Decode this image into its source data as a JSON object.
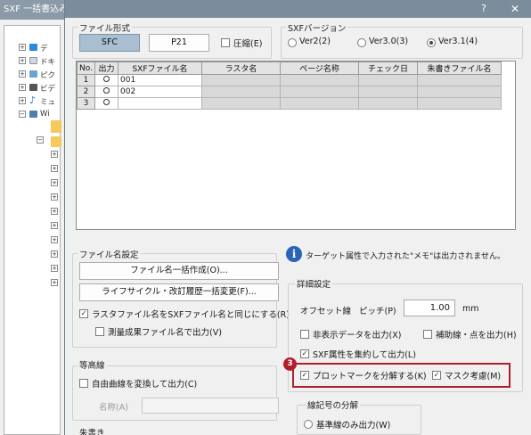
{
  "background_window": {
    "title": "SXF 一括書込み",
    "tree_items": [
      "デ",
      "ドキ",
      "ピク",
      "ビデ",
      "ミュ",
      "Wi"
    ]
  },
  "dialog": {
    "help": "?",
    "close": "✕",
    "file_format": {
      "title": "ファイル形式",
      "sfc": "SFC",
      "p21": "P21",
      "compress": "圧縮(E)"
    },
    "sxf_version": {
      "title": "SXFバージョン",
      "options": [
        "Ver2(2)",
        "Ver3.0(3)",
        "Ver3.1(4)"
      ],
      "selected": "Ver3.1(4)"
    },
    "grid": {
      "headers": [
        "No.",
        "出力",
        "SXFファイル名",
        "ラスタ名",
        "ページ名称",
        "チェック日",
        "朱書きファイル名"
      ],
      "rows": [
        {
          "no": "1",
          "out": "○",
          "name": "001"
        },
        {
          "no": "2",
          "out": "○",
          "name": "002"
        },
        {
          "no": "3",
          "out": "○",
          "name": ""
        }
      ]
    },
    "filename_settings": {
      "title": "ファイル名設定",
      "bulk_create": "ファイル名一括作成(O)...",
      "bulk_change": "ライフサイクル・改訂履歴一括変更(F)...",
      "same_as_sxf": "ラスタファイル名をSXFファイル名と同じにする(R)",
      "survey_output": "測量成果ファイル名で出力(V)"
    },
    "contour": {
      "title": "等高線",
      "convert_free_curve": "自由曲線を変換して出力(C)",
      "name_label": "名称(A)"
    },
    "red_writing_title": "朱書き",
    "info_text": "ターゲット属性で入力された\"メモ\"は出力されません。",
    "details": {
      "title": "詳細設定",
      "offset_line": "オフセット線",
      "pitch_label": "ピッチ(P)",
      "pitch_value": "1.00",
      "unit": "mm",
      "hidden_data": "非表示データを出力(X)",
      "aux_lines": "補助線・点を出力(H)",
      "aggregate_attr": "SXF属性を集約して出力(L)",
      "split_plot_mark": "プロットマークを分解する(K)",
      "mask": "マスク考慮(M)"
    },
    "line_symbol": {
      "title": "線記号の分解",
      "base_only": "基準線のみ出力(W)"
    },
    "badge": "3"
  },
  "colors": {
    "highlight": "#b01e2e",
    "selected_button": "#a9bfd1",
    "title_bar": "#7b8d9c"
  }
}
